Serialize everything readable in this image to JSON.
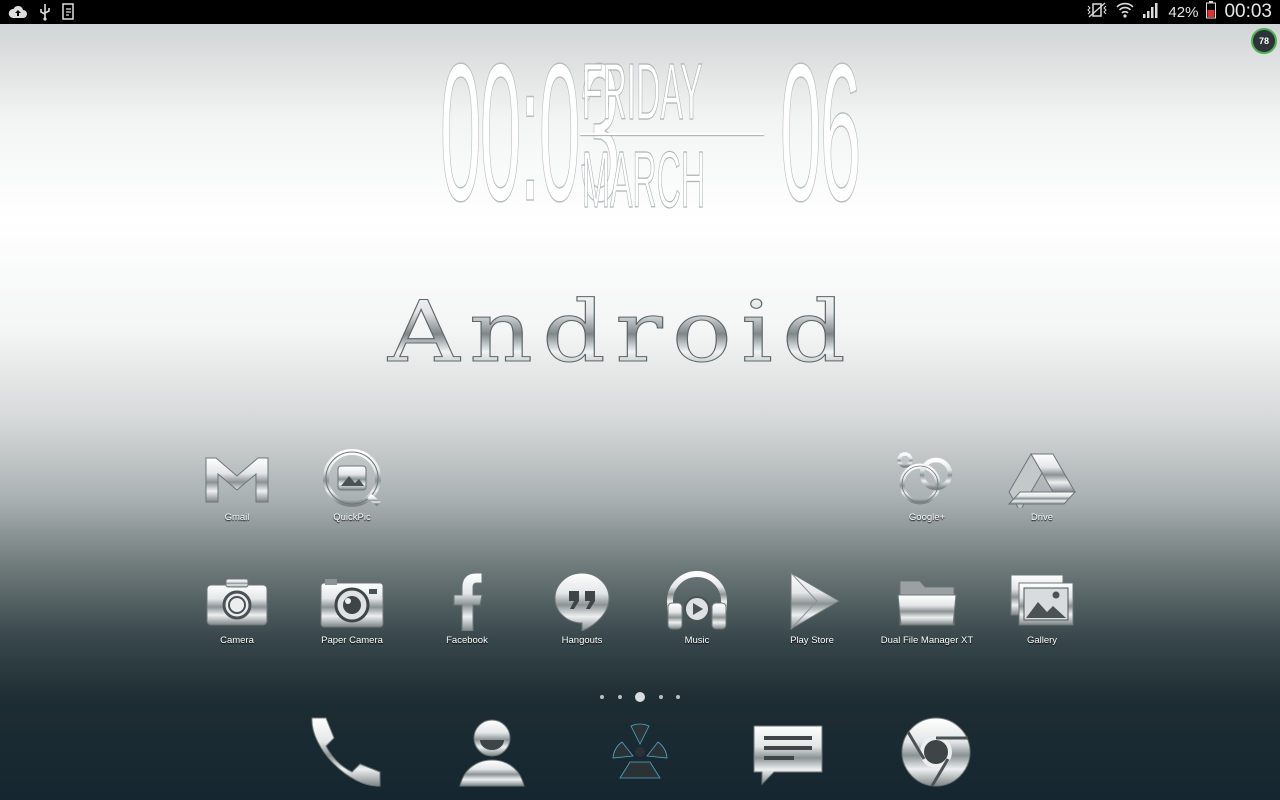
{
  "status_bar": {
    "left_icons": [
      "cloud-upload-icon",
      "usb-icon",
      "screenshot-icon"
    ],
    "right_icons": [
      "vibrate-icon",
      "wifi-icon",
      "signal-icon",
      "battery-icon"
    ],
    "battery_percent": "42%",
    "time": "00:03"
  },
  "battery_widget": {
    "value": "78",
    "color": "#4caf50"
  },
  "clock_widget": {
    "hours": "00",
    "separator": ":",
    "minutes": "03",
    "weekday": "FRIDAY",
    "month": "MARCH",
    "day": "06"
  },
  "logo_text": "Android",
  "apps_row1": [
    {
      "label": "Gmail",
      "icon": "gmail-icon"
    },
    {
      "label": "QuickPic",
      "icon": "quickpic-icon"
    },
    {
      "label": "Google+",
      "icon": "google-plus-icon"
    },
    {
      "label": "Drive",
      "icon": "drive-icon"
    }
  ],
  "apps_row2": [
    {
      "label": "Camera",
      "icon": "camera-icon"
    },
    {
      "label": "Paper Camera",
      "icon": "paper-camera-icon"
    },
    {
      "label": "Facebook",
      "icon": "facebook-icon"
    },
    {
      "label": "Hangouts",
      "icon": "hangouts-icon"
    },
    {
      "label": "Music",
      "icon": "music-icon"
    },
    {
      "label": "Play Store",
      "icon": "play-store-icon"
    },
    {
      "label": "Dual File Manager XT",
      "icon": "folder-icon"
    },
    {
      "label": "Gallery",
      "icon": "gallery-icon"
    }
  ],
  "page_indicator": {
    "pages": 5,
    "current": 3
  },
  "dock": [
    "phone-icon",
    "contacts-icon",
    "app-drawer-icon",
    "messaging-icon",
    "chrome-icon"
  ]
}
